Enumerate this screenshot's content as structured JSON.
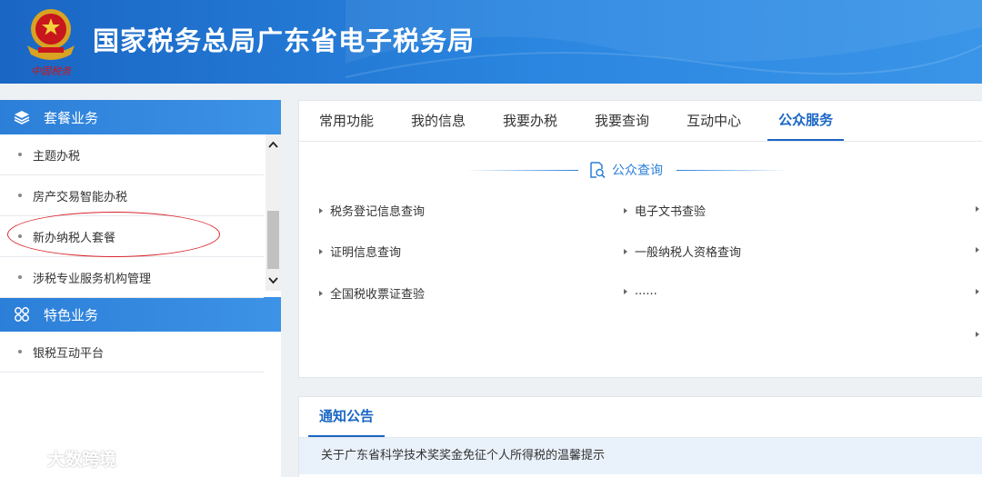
{
  "header": {
    "title": "国家税务总局广东省电子税务局",
    "emblem_icon": "tax-emblem-icon",
    "emblem_text": "中国税务"
  },
  "sidebar": {
    "sections": [
      {
        "title": "套餐业务",
        "icon": "layers-icon",
        "items": [
          "主题办税",
          "房产交易智能办税",
          "新办纳税人套餐",
          "涉税专业服务机构管理"
        ]
      },
      {
        "title": "特色业务",
        "icon": "grid-circles-icon",
        "items": [
          "银税互动平台"
        ]
      }
    ],
    "highlighted_item": "新办纳税人套餐"
  },
  "main": {
    "tabs": [
      {
        "label": "常用功能",
        "active": false
      },
      {
        "label": "我的信息",
        "active": false
      },
      {
        "label": "我要办税",
        "active": false
      },
      {
        "label": "我要查询",
        "active": false
      },
      {
        "label": "互动中心",
        "active": false
      },
      {
        "label": "公众服务",
        "active": true
      }
    ],
    "section_title": "公众查询",
    "links": [
      {
        "label": "税务登记信息查询"
      },
      {
        "label": "电子文书查验"
      },
      {
        "label": "证明信息查询"
      },
      {
        "label": "一般纳税人资格查询"
      },
      {
        "label": "全国税收票证查验"
      },
      {
        "label": "......"
      }
    ]
  },
  "notice": {
    "tab_label": "通知公告",
    "items": [
      "关于广东省科学技术奖奖金免征个人所得税的温馨提示"
    ]
  },
  "watermark": {
    "text": "大数跨境"
  },
  "colors": {
    "header_blue": "#1a66c4",
    "accent": "#2c7fd8",
    "highlight_circle": "#d9272e"
  }
}
